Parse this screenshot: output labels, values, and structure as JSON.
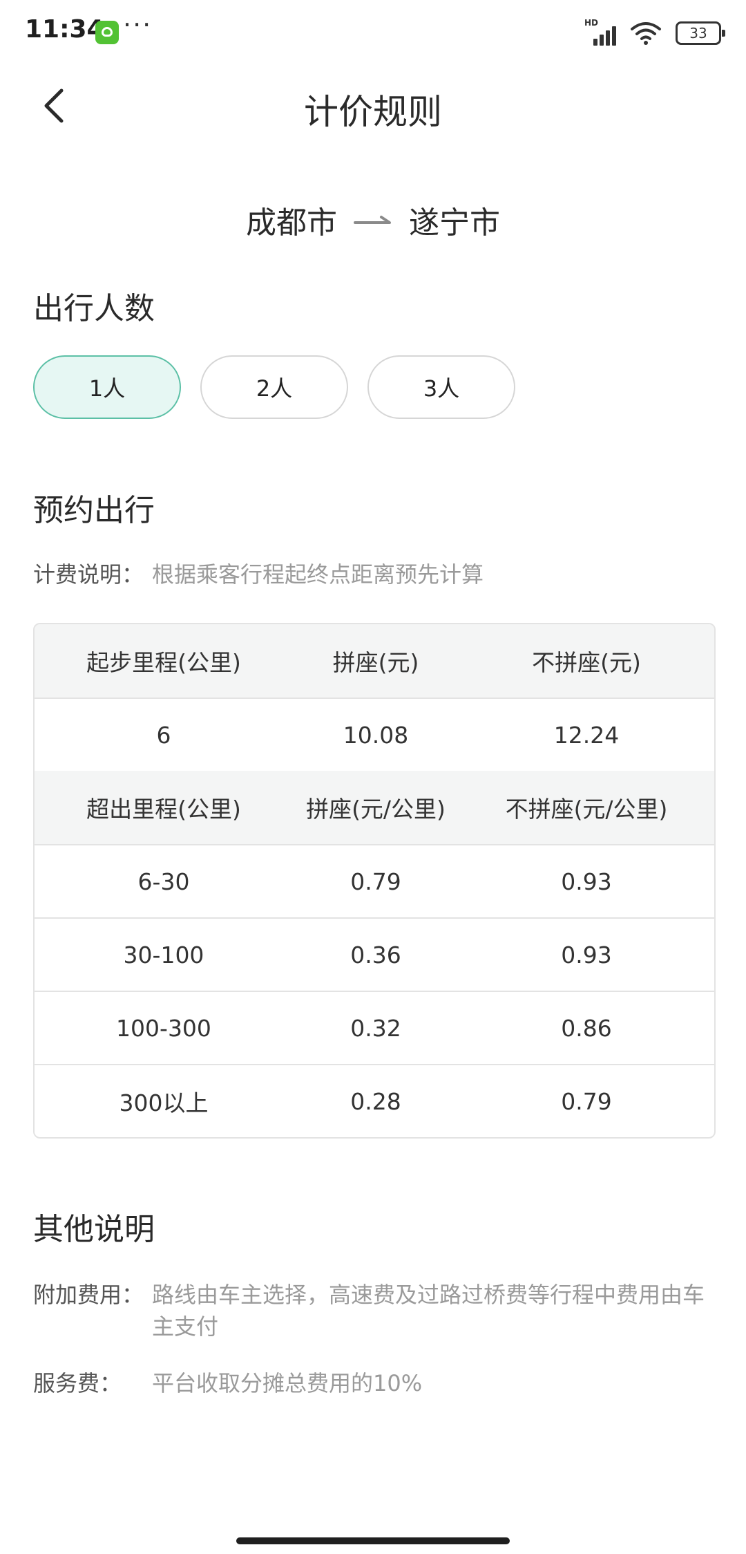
{
  "status_bar": {
    "time": "11:34",
    "hd_label": "HD",
    "battery": "33"
  },
  "header": {
    "title": "计价规则"
  },
  "route": {
    "from": "成都市",
    "to": "遂宁市"
  },
  "passengers": {
    "title": "出行人数",
    "options": [
      "1人",
      "2人",
      "3人"
    ],
    "selected": "1人"
  },
  "reservation": {
    "title": "预约出行",
    "billing_label": "计费说明：",
    "billing_text": "根据乘客行程起终点距离预先计算"
  },
  "table": {
    "start_headers": [
      "起步里程(公里)",
      "拼座(元)",
      "不拼座(元)"
    ],
    "start_row": [
      "6",
      "10.08",
      "12.24"
    ],
    "extra_headers": [
      "超出里程(公里)",
      "拼座(元/公里)",
      "不拼座(元/公里)"
    ],
    "extra_rows": [
      [
        "6-30",
        "0.79",
        "0.93"
      ],
      [
        "30-100",
        "0.36",
        "0.93"
      ],
      [
        "100-300",
        "0.32",
        "0.86"
      ],
      [
        "300以上",
        "0.28",
        "0.79"
      ]
    ]
  },
  "other": {
    "title": "其他说明",
    "extra_fee_label": "附加费用：",
    "extra_fee_text": "路线由车主选择，高速费及过路过桥费等行程中费用由车主支付",
    "service_fee_label": "服务费：",
    "service_fee_text": "平台收取分摊总费用的10%"
  },
  "colors": {
    "accent": "#5cc0a6",
    "selected_bg": "#e6f7f3",
    "app_icon": "#52c234"
  }
}
